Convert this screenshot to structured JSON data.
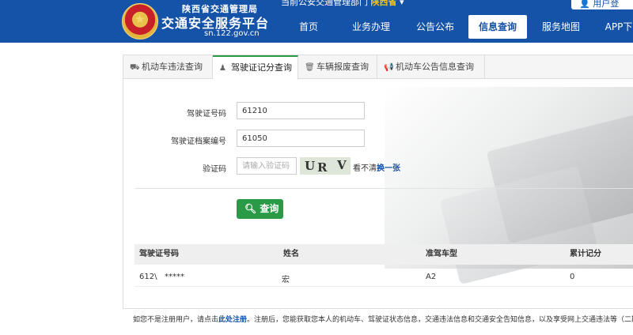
{
  "header": {
    "brand_sub": "陕西省交通管理局",
    "brand_main": "交通安全服务平台",
    "brand_url": "sn.122.gov.cn",
    "region_prefix": "当前公安交通管理部门",
    "region_name": "陕西省",
    "user_button": "用户登",
    "nav": [
      {
        "label": "首页"
      },
      {
        "label": "业务办理"
      },
      {
        "label": "公告公布"
      },
      {
        "label": "信息查询"
      },
      {
        "label": "服务地图"
      },
      {
        "label": "APP下"
      }
    ]
  },
  "tabs": [
    {
      "icon": "truck-icon",
      "label": "机动车违法查询"
    },
    {
      "icon": "person-icon",
      "label": "驾驶证记分查询"
    },
    {
      "icon": "trash-icon",
      "label": "车辆报废查询"
    },
    {
      "icon": "megaphone-icon",
      "label": "机动车公告信息查询"
    }
  ],
  "form": {
    "license_no": {
      "label": "驾驶证号码",
      "value": "61210"
    },
    "archive_no": {
      "label": "驾驶证档案编号",
      "value": "61050"
    },
    "captcha": {
      "label": "验证码",
      "placeholder": "请输入验证码",
      "image_text": "URV",
      "cant_see": "看不清?",
      "refresh": "换一张"
    },
    "query_button": "查询"
  },
  "table": {
    "headers": [
      "驾驶证号码",
      "姓名",
      "准驾车型",
      "累计记分"
    ],
    "rows": [
      {
        "license_no": "612\\",
        "license_mask": "*****",
        "name": "宏",
        "vehicle_class": "A2",
        "points": "0"
      }
    ]
  },
  "footer": {
    "prefix": "如您不是注册用户，请点击",
    "link": "此处注册",
    "suffix": "。注册后，您能获取您本人的机动车、驾驶证状态信息，交通违法信息和交通安全告知信息，以及享受网上交通违法等（二期开放"
  },
  "colors": {
    "header_bg": "#1553a8",
    "accent_green": "#2a9a46",
    "region_highlight": "#f5c518"
  }
}
